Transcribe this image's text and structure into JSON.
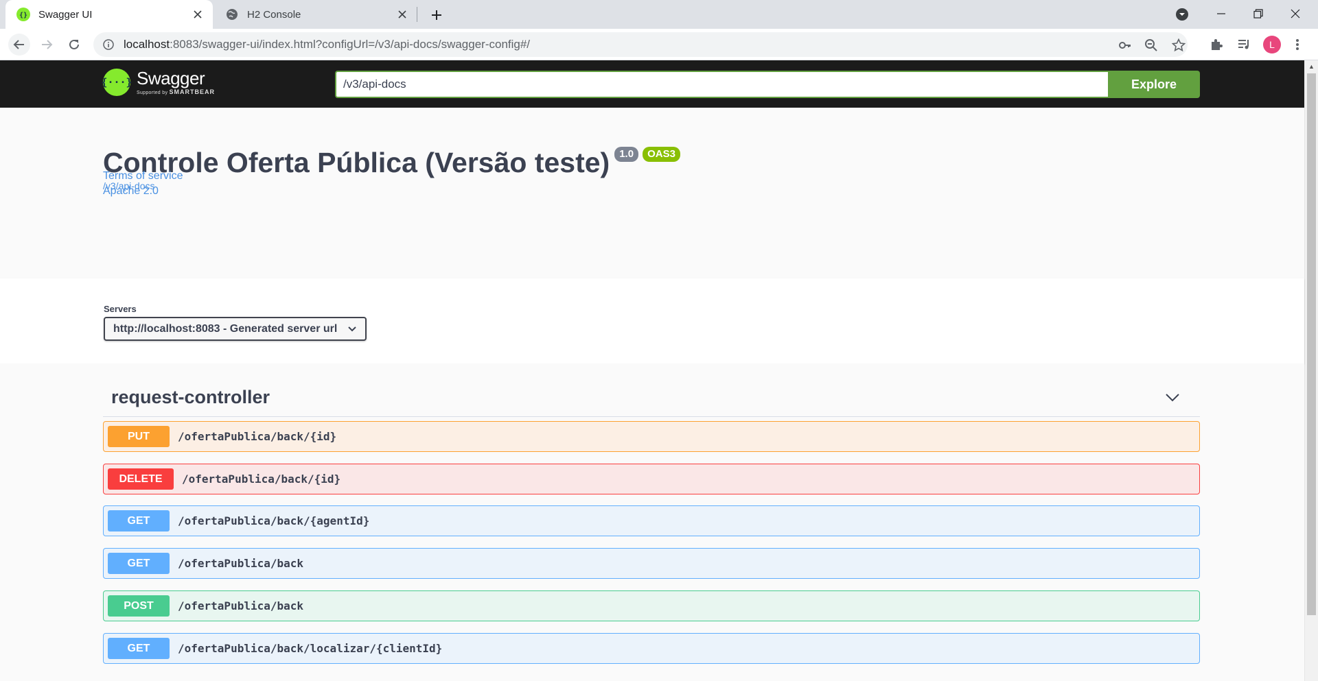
{
  "browser": {
    "tabs": [
      {
        "title": "Swagger UI",
        "active": true
      },
      {
        "title": "H2 Console",
        "active": false
      }
    ],
    "url_host": "localhost",
    "url_rest": ":8083/swagger-ui/index.html?configUrl=/v3/api-docs/swagger-config#/",
    "avatar_letter": "L"
  },
  "topbar": {
    "logo_brand": "Swagger",
    "logo_sub": "Supported by",
    "logo_sub_brand": "SMARTBEAR",
    "spec_url": "/v3/api-docs",
    "explore_label": "Explore"
  },
  "info": {
    "title": "Controle Oferta Pública (Versão teste)",
    "version": "1.0",
    "oas_badge": "OAS3",
    "spec_link": "/v3/api-docs",
    "terms_link": "Terms of service",
    "license_link": "Apache 2.0"
  },
  "servers": {
    "label": "Servers",
    "selected": "http://localhost:8083 - Generated server url"
  },
  "tag": {
    "name": "request-controller"
  },
  "operations": [
    {
      "method": "PUT",
      "path": "/ofertaPublica/back/{id}"
    },
    {
      "method": "DELETE",
      "path": "/ofertaPublica/back/{id}"
    },
    {
      "method": "GET",
      "path": "/ofertaPublica/back/{agentId}"
    },
    {
      "method": "GET",
      "path": "/ofertaPublica/back"
    },
    {
      "method": "POST",
      "path": "/ofertaPublica/back"
    },
    {
      "method": "GET",
      "path": "/ofertaPublica/back/localizar/{clientId}"
    }
  ],
  "colors": {
    "put": "#fca130",
    "delete": "#f93e3e",
    "get": "#61affe",
    "post": "#49cc90",
    "explore": "#62a03f"
  }
}
